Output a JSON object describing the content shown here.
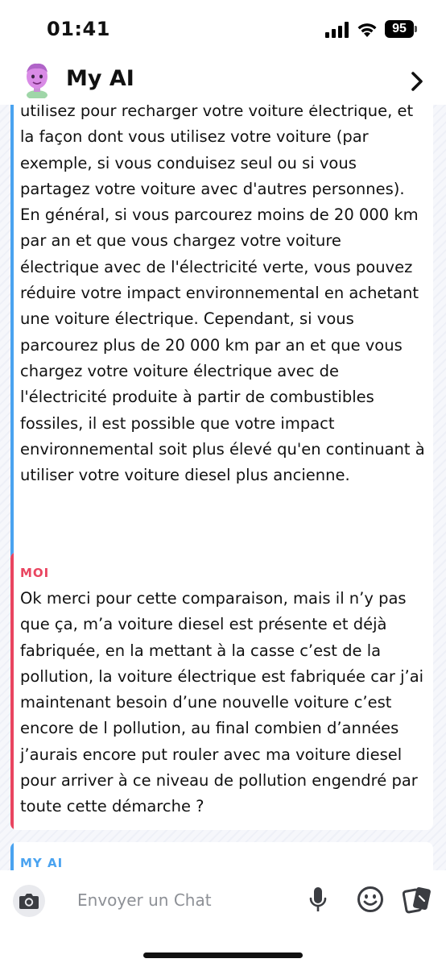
{
  "status_bar": {
    "time": "01:41",
    "battery": "95"
  },
  "header": {
    "title": "My AI"
  },
  "colors": {
    "ai_accent": "#4aa3f0",
    "me_accent": "#e94560"
  },
  "messages": [
    {
      "sender": "MY AI",
      "text": "utilisez pour recharger votre voiture électrique, et la façon dont vous utilisez votre voiture (par exemple, si vous conduisez seul ou si vous partagez votre voiture avec d'autres personnes). En général, si vous parcourez moins de 20 000 km par an et que vous chargez votre voiture électrique avec de l'électricité verte, vous pouvez réduire votre impact environnemental en achetant une voiture électrique. Cependant, si vous parcourez plus de 20 000 km par an et que vous chargez votre voiture électrique avec de l'électricité produite à partir de combustibles fossiles, il est possible que votre impact environnemental soit plus élevé qu'en continuant à utiliser votre voiture diesel plus ancienne."
    },
    {
      "sender": "MOI",
      "text": "Ok merci pour cette comparaison, mais il n’y pas que ça, m’a voiture diesel est présente et déjà fabriquée, en la mettant à la casse c’est de la pollution, la voiture électrique est fabriquée car j’ai maintenant besoin d’une nouvelle voiture c’est encore de l pollution, au final combien d’années j’aurais encore put rouler avec ma voiture diesel pour arriver à ce niveau de pollution engendré par toute cette démarche ?"
    },
    {
      "sender": "MY AI",
      "text": ""
    }
  ],
  "input": {
    "placeholder": "Envoyer un Chat"
  },
  "icons": {
    "camera": "camera-icon",
    "mic": "microphone-icon",
    "smiley": "smiley-icon",
    "cards": "cards-icon",
    "back": "chevron-right-icon"
  }
}
